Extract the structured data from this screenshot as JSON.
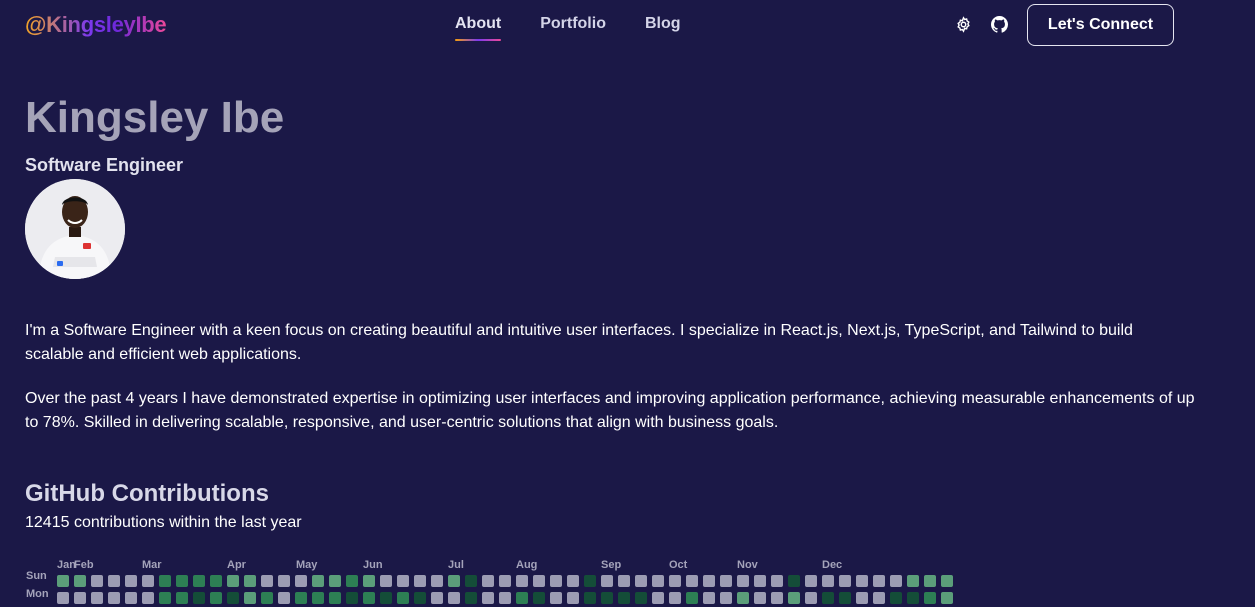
{
  "nav": {
    "logo": "@KingsleyIbe",
    "links": [
      {
        "label": "About",
        "active": true
      },
      {
        "label": "Portfolio",
        "active": false
      },
      {
        "label": "Blog",
        "active": false
      }
    ],
    "theme_icon": "gear-icon",
    "github_icon": "github-icon",
    "connect_label": "Let's Connect"
  },
  "profile": {
    "name": "Kingsley Ibe",
    "role": "Software Engineer"
  },
  "about": {
    "paragraph_1": "I'm a Software Engineer with a keen focus on creating beautiful and intuitive user interfaces. I specialize in React.js, Next.js, TypeScript, and Tailwind to build scalable and efficient web applications.",
    "paragraph_2": "Over the past 4 years I have demonstrated expertise in optimizing user interfaces and improving application performance, achieving measurable enhancements of up to 78%. Skilled in delivering scalable, responsive, and user-centric solutions that align with business goals."
  },
  "github": {
    "title": "GitHub Contributions",
    "subtitle": "12415 contributions within the last year",
    "months": [
      "Jan",
      "Feb",
      "Mar",
      "Apr",
      "May",
      "Jun",
      "Jul",
      "Aug",
      "Sep",
      "Oct",
      "Nov",
      "Dec"
    ],
    "days": [
      "Sun",
      "Mon"
    ],
    "levels": {
      "Sun": [
        3,
        3,
        0,
        0,
        0,
        0,
        2,
        2,
        2,
        2,
        3,
        3,
        0,
        0,
        0,
        3,
        3,
        2,
        3,
        0,
        0,
        0,
        0,
        3,
        1,
        0,
        0,
        0,
        0,
        0,
        0,
        1,
        0,
        0,
        0,
        0,
        0,
        0,
        0,
        0,
        0,
        0,
        0,
        1,
        0,
        0,
        0,
        0,
        0,
        0,
        3,
        3,
        3,
        3,
        3,
        0,
        0,
        0,
        3
      ],
      "Mon": [
        0,
        0,
        0,
        0,
        0,
        0,
        2,
        2,
        1,
        2,
        1,
        3,
        2,
        0,
        2,
        2,
        2,
        1,
        2,
        1,
        2,
        1,
        0,
        0,
        1,
        0,
        0,
        2,
        1,
        0,
        0,
        1,
        1,
        1,
        1,
        0,
        0,
        2,
        0,
        0,
        3,
        0,
        0,
        3,
        0,
        1,
        1,
        0,
        0,
        1,
        1,
        2,
        3,
        3,
        3,
        3,
        3,
        2,
        3
      ]
    },
    "level_colors": [
      "#9c9cb3",
      "#144d38",
      "#2d7f54",
      "#5b9e7a"
    ]
  }
}
